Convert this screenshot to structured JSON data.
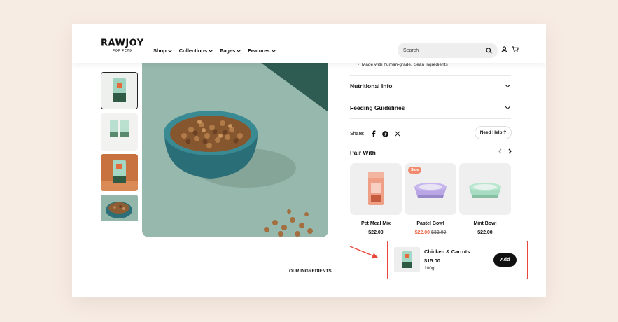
{
  "brand": {
    "name": "RAWJOY",
    "tagline": "FOR PETS"
  },
  "nav": {
    "items": [
      {
        "label": "Shop"
      },
      {
        "label": "Collections"
      },
      {
        "label": "Pages"
      },
      {
        "label": "Features"
      }
    ]
  },
  "search": {
    "placeholder": "Search"
  },
  "product": {
    "bullet": "Made with human-grade, clean ingredients",
    "accordions": [
      "Nutritional Info",
      "Feeding Guidelines"
    ],
    "share_label": "Share:",
    "help_label": "Need Help ?",
    "ingredients_label": "OUR INGREDIENTS"
  },
  "pair": {
    "title": "Pair With",
    "items": [
      {
        "name": "Pet Meal Mix",
        "price": "$22.00"
      },
      {
        "name": "Pastel Bowl",
        "sale_price": "$22.00",
        "old_price": "$32.00",
        "badge": "Sale"
      },
      {
        "name": "Mint Bowl",
        "price": "$22.00"
      }
    ]
  },
  "sticky": {
    "title": "Chicken & Carrots",
    "price": "$15.00",
    "weight": "100gr",
    "add_label": "Add"
  },
  "colors": {
    "accent_sale": "#e8613f",
    "highlight_border": "#e8463a",
    "bg": "#f7ece4"
  },
  "icons": [
    "search-icon",
    "user-icon",
    "cart-icon",
    "facebook-icon",
    "pinterest-icon",
    "x-icon"
  ]
}
